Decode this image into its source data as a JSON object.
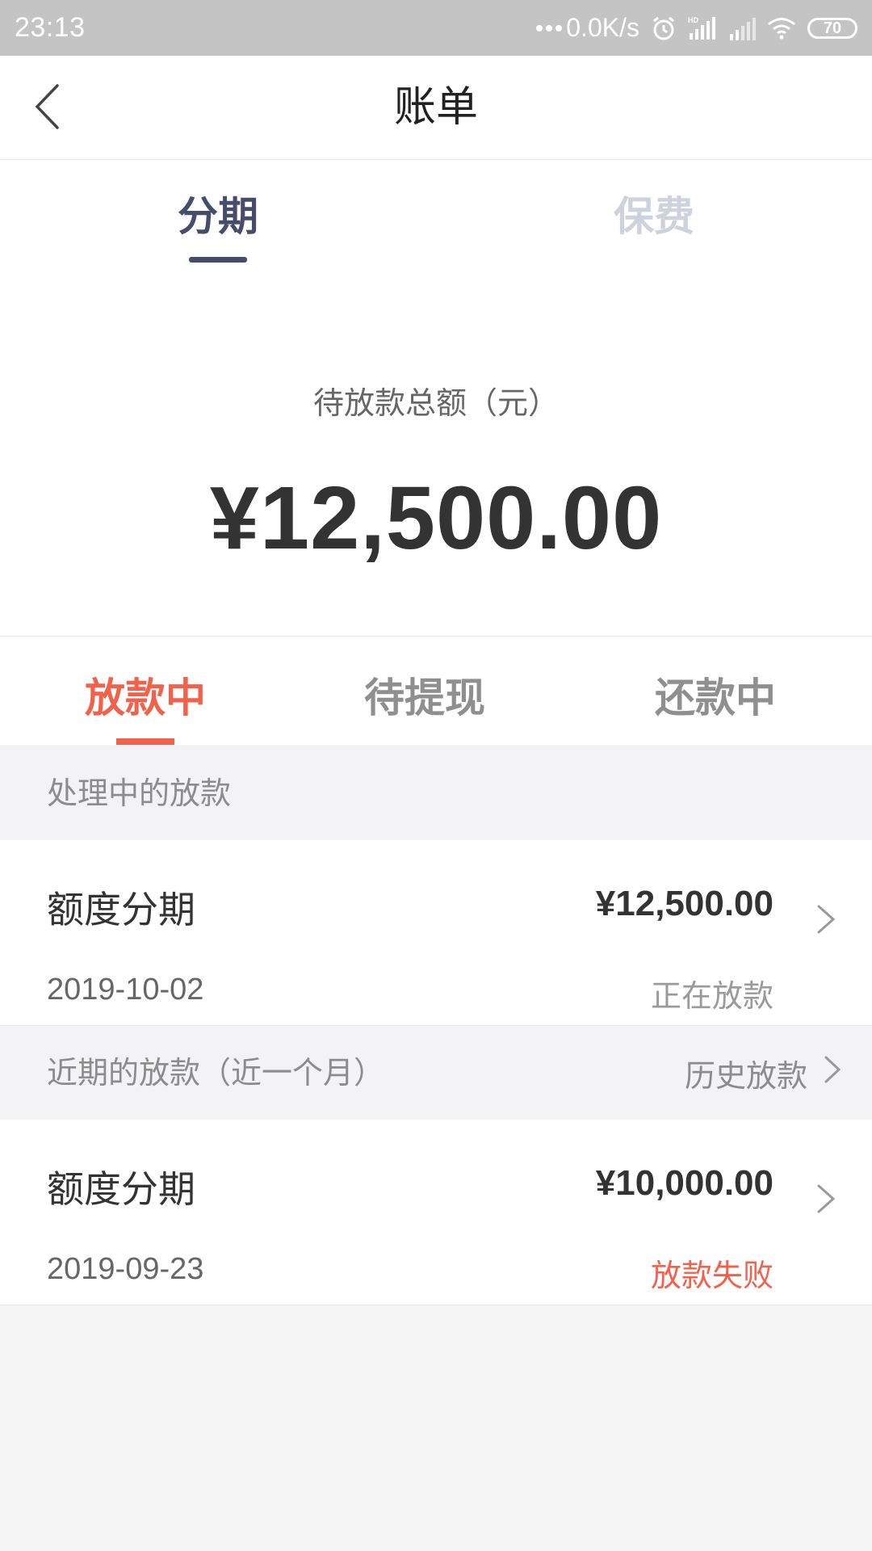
{
  "status_bar": {
    "time": "23:13",
    "network_speed": "0.0K/s",
    "battery_level": "70",
    "icons": [
      "dots-icon",
      "alarm-icon",
      "hd-signal-icon",
      "signal-icon",
      "wifi-icon",
      "battery-icon"
    ]
  },
  "header": {
    "title": "账单",
    "back_icon": "chevron-left-icon"
  },
  "main_tabs": [
    {
      "label": "分期",
      "active": true
    },
    {
      "label": "保费",
      "active": false
    }
  ],
  "summary": {
    "label": "待放款总额（元）",
    "amount": "¥12,500.00"
  },
  "sub_tabs": [
    {
      "label": "放款中",
      "active": true
    },
    {
      "label": "待提现",
      "active": false
    },
    {
      "label": "还款中",
      "active": false
    }
  ],
  "sections": [
    {
      "title": "处理中的放款",
      "items": [
        {
          "title": "额度分期",
          "amount": "¥12,500.00",
          "date": "2019-10-02",
          "status": "正在放款",
          "status_color": "#9a9a9a"
        }
      ]
    },
    {
      "title": "近期的放款（近一个月）",
      "link_label": "历史放款",
      "items": [
        {
          "title": "额度分期",
          "amount": "¥10,000.00",
          "date": "2019-09-23",
          "status": "放款失败",
          "status_color": "#f2614b"
        }
      ]
    }
  ],
  "colors": {
    "accent_red": "#f2614b",
    "tab_active": "#474c6b",
    "tab_inactive": "#cdd2dc",
    "status_bar": "#c4c4c4"
  }
}
